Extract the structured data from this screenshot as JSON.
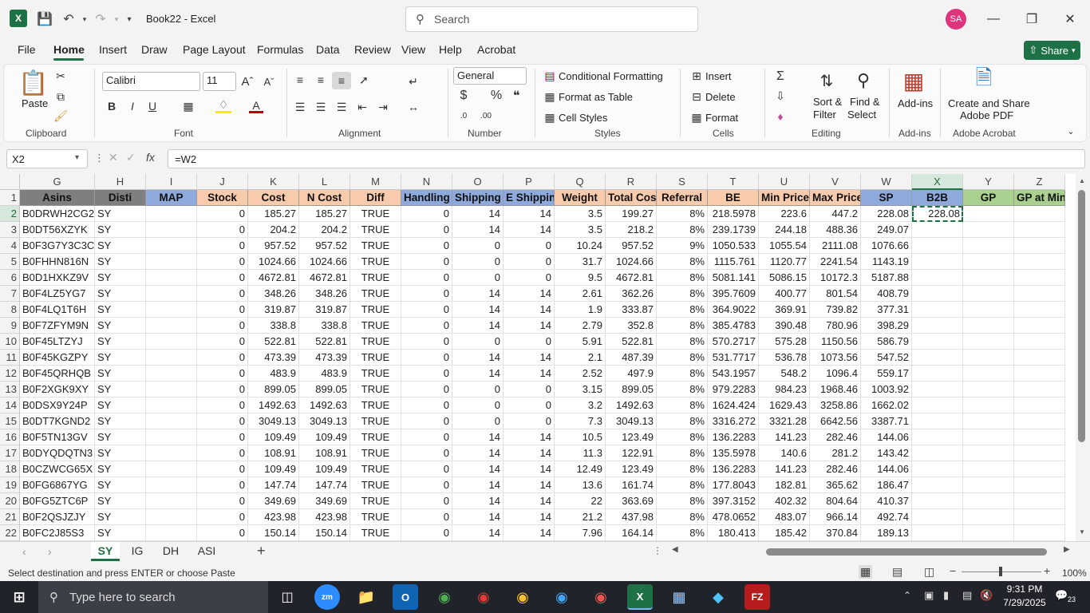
{
  "window": {
    "title": "Book22 - Excel",
    "search_placeholder": "Search",
    "avatar": "SA"
  },
  "menu": [
    "File",
    "Home",
    "Insert",
    "Draw",
    "Page Layout",
    "Formulas",
    "Data",
    "Review",
    "View",
    "Help",
    "Acrobat"
  ],
  "share_label": "Share",
  "ribbon": {
    "clipboard": {
      "paste": "Paste",
      "label": "Clipboard"
    },
    "font": {
      "name": "Calibri",
      "size": "11",
      "label": "Font"
    },
    "alignment": {
      "label": "Alignment"
    },
    "number": {
      "format": "General",
      "label": "Number"
    },
    "styles": {
      "conditional": "Conditional Formatting",
      "format_table": "Format as Table",
      "cell_styles": "Cell Styles",
      "label": "Styles"
    },
    "cells": {
      "insert": "Insert",
      "delete": "Delete",
      "format": "Format",
      "label": "Cells"
    },
    "editing": {
      "sort": "Sort &",
      "sort2": "Filter",
      "find": "Find &",
      "find2": "Select",
      "label": "Editing"
    },
    "addins": {
      "btn": "Add-ins",
      "label": "Add-ins"
    },
    "acrobat": {
      "btn1": "Create and Share",
      "btn2": "Adobe PDF",
      "label": "Adobe Acrobat"
    }
  },
  "formula_bar": {
    "name_box": "X2",
    "formula": "=W2",
    "fx": "fx"
  },
  "columns": [
    "G",
    "H",
    "I",
    "J",
    "K",
    "L",
    "M",
    "N",
    "O",
    "P",
    "Q",
    "R",
    "S",
    "T",
    "U",
    "V",
    "W",
    "X",
    "Y",
    "Z"
  ],
  "headers": [
    "Asins",
    "Disti",
    "MAP",
    "Stock",
    "Cost",
    "N Cost",
    "Diff",
    "Handling",
    "Shipping",
    "E Shipping",
    "Weight",
    "Total Cost",
    "Referral",
    "BE",
    "Min Price",
    "Max Price",
    "SP",
    "B2B",
    "GP",
    "GP at Min"
  ],
  "rows": [
    [
      "B0DRWH2CG2",
      "SY",
      "",
      "0",
      "185.27",
      "185.27",
      "TRUE",
      "0",
      "14",
      "14",
      "3.5",
      "199.27",
      "8%",
      "218.5978",
      "223.6",
      "447.2",
      "228.08",
      "228.08",
      "",
      ""
    ],
    [
      "B0DT56XZYK",
      "SY",
      "",
      "0",
      "204.2",
      "204.2",
      "TRUE",
      "0",
      "14",
      "14",
      "3.5",
      "218.2",
      "8%",
      "239.1739",
      "244.18",
      "488.36",
      "249.07",
      "",
      "",
      ""
    ],
    [
      "B0F3G7Y3C3C",
      "SY",
      "",
      "0",
      "957.52",
      "957.52",
      "TRUE",
      "0",
      "0",
      "0",
      "10.24",
      "957.52",
      "9%",
      "1050.533",
      "1055.54",
      "2111.08",
      "1076.66",
      "",
      "",
      ""
    ],
    [
      "B0FHHN816N",
      "SY",
      "",
      "0",
      "1024.66",
      "1024.66",
      "TRUE",
      "0",
      "0",
      "0",
      "31.7",
      "1024.66",
      "8%",
      "1115.761",
      "1120.77",
      "2241.54",
      "1143.19",
      "",
      "",
      ""
    ],
    [
      "B0D1HXKZ9V",
      "SY",
      "",
      "0",
      "4672.81",
      "4672.81",
      "TRUE",
      "0",
      "0",
      "0",
      "9.5",
      "4672.81",
      "8%",
      "5081.141",
      "5086.15",
      "10172.3",
      "5187.88",
      "",
      "",
      ""
    ],
    [
      "B0F4LZ5YG7",
      "SY",
      "",
      "0",
      "348.26",
      "348.26",
      "TRUE",
      "0",
      "14",
      "14",
      "2.61",
      "362.26",
      "8%",
      "395.7609",
      "400.77",
      "801.54",
      "408.79",
      "",
      "",
      ""
    ],
    [
      "B0F4LQ1T6H",
      "SY",
      "",
      "0",
      "319.87",
      "319.87",
      "TRUE",
      "0",
      "14",
      "14",
      "1.9",
      "333.87",
      "8%",
      "364.9022",
      "369.91",
      "739.82",
      "377.31",
      "",
      "",
      ""
    ],
    [
      "B0F7ZFYM9N",
      "SY",
      "",
      "0",
      "338.8",
      "338.8",
      "TRUE",
      "0",
      "14",
      "14",
      "2.79",
      "352.8",
      "8%",
      "385.4783",
      "390.48",
      "780.96",
      "398.29",
      "",
      "",
      ""
    ],
    [
      "B0F45LTZYJ",
      "SY",
      "",
      "0",
      "522.81",
      "522.81",
      "TRUE",
      "0",
      "0",
      "0",
      "5.91",
      "522.81",
      "8%",
      "570.2717",
      "575.28",
      "1150.56",
      "586.79",
      "",
      "",
      ""
    ],
    [
      "B0F45KGZPY",
      "SY",
      "",
      "0",
      "473.39",
      "473.39",
      "TRUE",
      "0",
      "14",
      "14",
      "2.1",
      "487.39",
      "8%",
      "531.7717",
      "536.78",
      "1073.56",
      "547.52",
      "",
      "",
      ""
    ],
    [
      "B0F45QRHQB",
      "SY",
      "",
      "0",
      "483.9",
      "483.9",
      "TRUE",
      "0",
      "14",
      "14",
      "2.52",
      "497.9",
      "8%",
      "543.1957",
      "548.2",
      "1096.4",
      "559.17",
      "",
      "",
      ""
    ],
    [
      "B0F2XGK9XY",
      "SY",
      "",
      "0",
      "899.05",
      "899.05",
      "TRUE",
      "0",
      "0",
      "0",
      "3.15",
      "899.05",
      "8%",
      "979.2283",
      "984.23",
      "1968.46",
      "1003.92",
      "",
      "",
      ""
    ],
    [
      "B0DSX9Y24P",
      "SY",
      "",
      "0",
      "1492.63",
      "1492.63",
      "TRUE",
      "0",
      "0",
      "0",
      "3.2",
      "1492.63",
      "8%",
      "1624.424",
      "1629.43",
      "3258.86",
      "1662.02",
      "",
      "",
      ""
    ],
    [
      "B0DT7KGND2",
      "SY",
      "",
      "0",
      "3049.13",
      "3049.13",
      "TRUE",
      "0",
      "0",
      "0",
      "7.3",
      "3049.13",
      "8%",
      "3316.272",
      "3321.28",
      "6642.56",
      "3387.71",
      "",
      "",
      ""
    ],
    [
      "B0F5TN13GV",
      "SY",
      "",
      "0",
      "109.49",
      "109.49",
      "TRUE",
      "0",
      "14",
      "14",
      "10.5",
      "123.49",
      "8%",
      "136.2283",
      "141.23",
      "282.46",
      "144.06",
      "",
      "",
      ""
    ],
    [
      "B0DYQDQTN3",
      "SY",
      "",
      "0",
      "108.91",
      "108.91",
      "TRUE",
      "0",
      "14",
      "14",
      "11.3",
      "122.91",
      "8%",
      "135.5978",
      "140.6",
      "281.2",
      "143.42",
      "",
      "",
      ""
    ],
    [
      "B0CZWCG65X",
      "SY",
      "",
      "0",
      "109.49",
      "109.49",
      "TRUE",
      "0",
      "14",
      "14",
      "12.49",
      "123.49",
      "8%",
      "136.2283",
      "141.23",
      "282.46",
      "144.06",
      "",
      "",
      ""
    ],
    [
      "B0FG6867YG",
      "SY",
      "",
      "0",
      "147.74",
      "147.74",
      "TRUE",
      "0",
      "14",
      "14",
      "13.6",
      "161.74",
      "8%",
      "177.8043",
      "182.81",
      "365.62",
      "186.47",
      "",
      "",
      ""
    ],
    [
      "B0FG5ZTC6P",
      "SY",
      "",
      "0",
      "349.69",
      "349.69",
      "TRUE",
      "0",
      "14",
      "14",
      "22",
      "363.69",
      "8%",
      "397.3152",
      "402.32",
      "804.64",
      "410.37",
      "",
      "",
      ""
    ],
    [
      "B0F2QSJZJY",
      "SY",
      "",
      "0",
      "423.98",
      "423.98",
      "TRUE",
      "0",
      "14",
      "14",
      "21.2",
      "437.98",
      "8%",
      "478.0652",
      "483.07",
      "966.14",
      "492.74",
      "",
      "",
      ""
    ],
    [
      "B0FC2J85S3",
      "SY",
      "",
      "0",
      "150.14",
      "150.14",
      "TRUE",
      "0",
      "14",
      "14",
      "7.96",
      "164.14",
      "8%",
      "180.413",
      "185.42",
      "370.84",
      "189.13",
      "",
      "",
      ""
    ]
  ],
  "sheets": [
    "SY",
    "IG",
    "DH",
    "ASI"
  ],
  "status": {
    "message": "Select destination and press ENTER or choose Paste",
    "zoom": "100%"
  },
  "taskbar": {
    "search": "Type here to search",
    "time": "9:31 PM",
    "date": "7/29/2025",
    "notif": "23"
  },
  "colors": {
    "excel_green": "#1e7145",
    "hdr_gray": "#7f7f7f",
    "hdr_blue": "#8ea9db",
    "hdr_peach": "#f8cbad",
    "hdr_green": "#a9d08e"
  }
}
